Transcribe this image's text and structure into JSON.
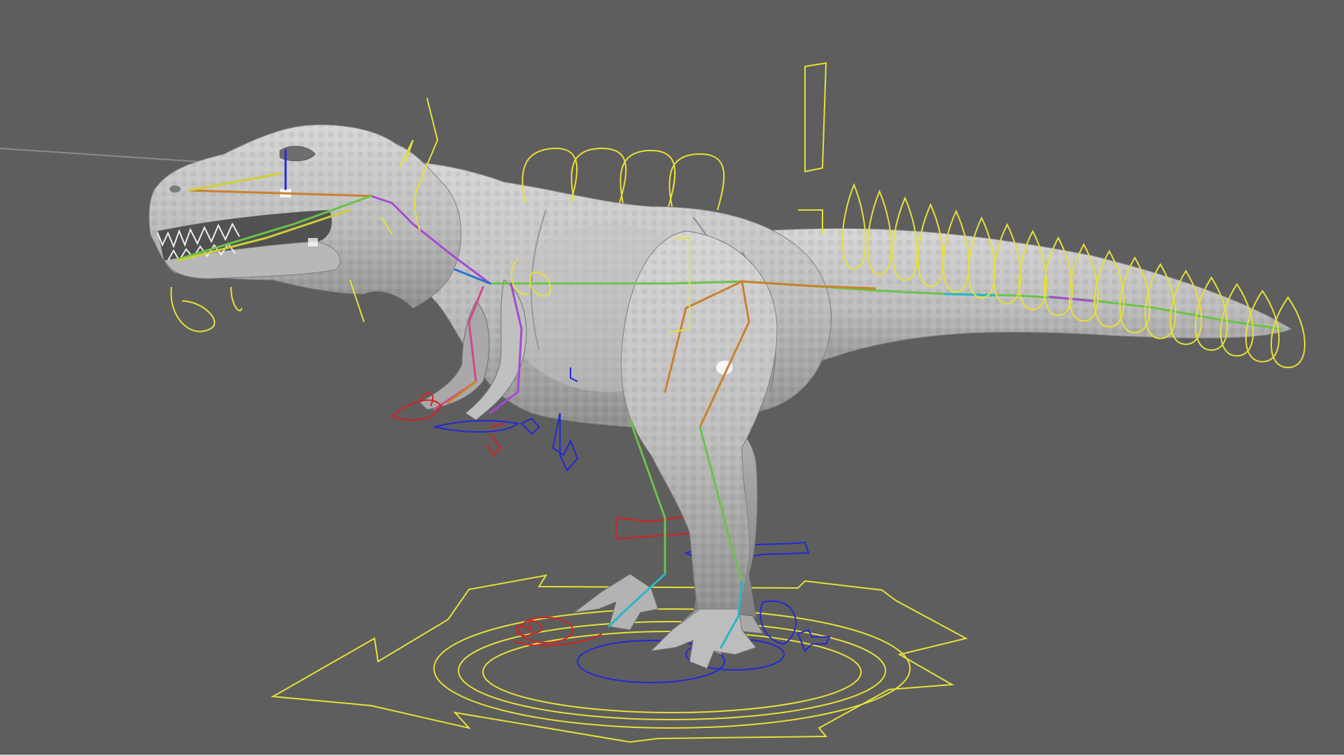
{
  "viewport": {
    "background": "#5e5e5e",
    "label": ""
  },
  "model": {
    "subject": "t-rex",
    "shading": "smooth-shaded-gray",
    "mesh_color": "#c9c9c9",
    "mesh_shadow": "#9a9a9a"
  },
  "rig": {
    "control_colors": {
      "center": "#e6e03a",
      "left": "#d42222",
      "right": "#2428d6"
    },
    "bone_colors": [
      "#c9822e",
      "#6cc24a",
      "#29b7c4",
      "#a64ad1",
      "#cfcf36"
    ],
    "spine_controls": 4,
    "tail_controls": 18,
    "root_control": "master-ring-with-arrows"
  }
}
